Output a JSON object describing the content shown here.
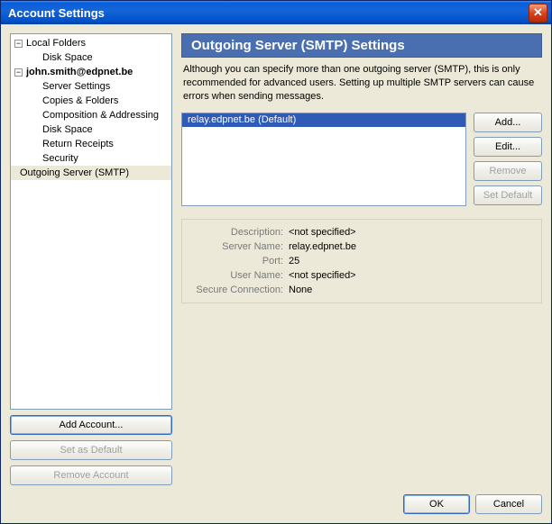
{
  "window": {
    "title": "Account Settings"
  },
  "tree": {
    "local_folders": "Local Folders",
    "disk_space": "Disk Space",
    "account": "john.smith@edpnet.be",
    "server_settings": "Server Settings",
    "copies_folders": "Copies & Folders",
    "composition": "Composition & Addressing",
    "disk_space2": "Disk Space",
    "return_receipts": "Return Receipts",
    "security": "Security",
    "outgoing": "Outgoing Server (SMTP)"
  },
  "left_buttons": {
    "add_account": "Add Account...",
    "set_default": "Set as Default",
    "remove_account": "Remove Account"
  },
  "panel": {
    "header": "Outgoing Server (SMTP) Settings",
    "description": "Although you can specify more than one outgoing server (SMTP), this is only recommended for advanced users. Setting up multiple SMTP servers can cause errors when sending messages.",
    "server_item": "relay.edpnet.be (Default)"
  },
  "buttons": {
    "add": "Add...",
    "edit": "Edit...",
    "remove": "Remove",
    "set_default": "Set Default"
  },
  "details": {
    "desc_label": "Description:",
    "desc_value": "<not specified>",
    "server_label": "Server Name:",
    "server_value": "relay.edpnet.be",
    "port_label": "Port:",
    "port_value": "25",
    "user_label": "User Name:",
    "user_value": "<not specified>",
    "secure_label": "Secure Connection:",
    "secure_value": "None"
  },
  "footer": {
    "ok": "OK",
    "cancel": "Cancel"
  }
}
